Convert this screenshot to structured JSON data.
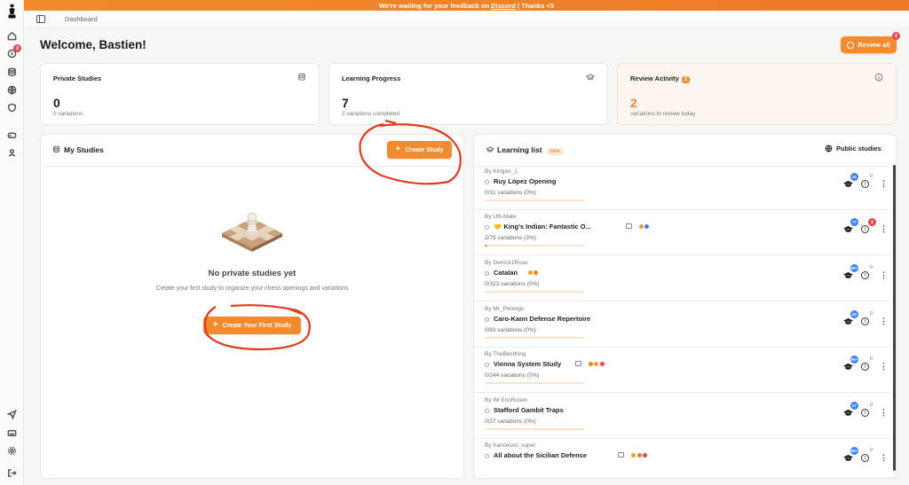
{
  "banner": {
    "before": "We're waiting for your feedback on",
    "link": "Discord",
    "after": "| Thanks <3"
  },
  "topbar": {
    "breadcrumb": "Dashboard"
  },
  "sidebar": {
    "notification_count": "2"
  },
  "header": {
    "welcome": "Welcome, Bastien!",
    "review_all_label": "Review all",
    "review_all_badge": "2"
  },
  "stats": {
    "private": {
      "title": "Private Studies",
      "value": "0",
      "sub": "0 variations"
    },
    "learning": {
      "title": "Learning Progress",
      "value": "7",
      "sub": "2 variations completed"
    },
    "review": {
      "title": "Review Activity",
      "badge": "2",
      "value": "2",
      "sub": "variations to review today"
    }
  },
  "my_studies": {
    "title": "My Studies",
    "create_label": "Create Study",
    "empty_title": "No private studies yet",
    "empty_sub": "Create your first study to organize your chess openings and variations",
    "create_first_label": "Create Your First Study"
  },
  "learning_list": {
    "title": "Learning list",
    "new_label": "new",
    "public_label": "Public studies",
    "items": [
      {
        "author": "By Kingoo_1",
        "name": "Ruy López Opening",
        "progress": "0/31 variations (0%)",
        "pct": 0,
        "blue": "31",
        "count": "0",
        "book": false,
        "dots": []
      },
      {
        "author": "By Ulti-Mate",
        "name": "🤝 King's Indian: Fantastic O...",
        "progress": "2/79 variations (3%)",
        "pct": 3,
        "blue": "77",
        "red": "2",
        "book": true,
        "dots": [
          "#e89e2c",
          "#3b82f6"
        ]
      },
      {
        "author": "By Derrick1Rose",
        "name": "Catalan",
        "progress": "0/323 variations (0%)",
        "pct": 0,
        "blue": "99+",
        "count": "0",
        "book": false,
        "dots": [
          "#f0a020",
          "#e8830f"
        ]
      },
      {
        "author": "By Mr_Penings",
        "name": "Caro-Kann Defense Repertoire",
        "progress": "0/83 variations (0%)",
        "pct": 0,
        "blue": "83",
        "count": "0",
        "book": false,
        "dots": []
      },
      {
        "author": "By TheBestKing",
        "name": "Vienna System Study",
        "progress": "0/244 variations (0%)",
        "pct": 0,
        "blue": "99+",
        "count": "0",
        "book": true,
        "dots": [
          "#e8830f",
          "#f0a020",
          "#e5484d"
        ]
      },
      {
        "author": "By IM EricRosen",
        "name": "Stafford Gambit Traps",
        "progress": "0/27 variations (0%)",
        "pct": 0,
        "blue": "27",
        "count": "0",
        "book": false,
        "dots": []
      },
      {
        "author": "By francesco_super",
        "name": "All about the Sicilian Defense",
        "progress": "",
        "pct": 0,
        "blue": "99+",
        "count": "0",
        "book": true,
        "dots": [
          "#f0a020",
          "#e8830f",
          "#e5484d"
        ]
      }
    ]
  }
}
